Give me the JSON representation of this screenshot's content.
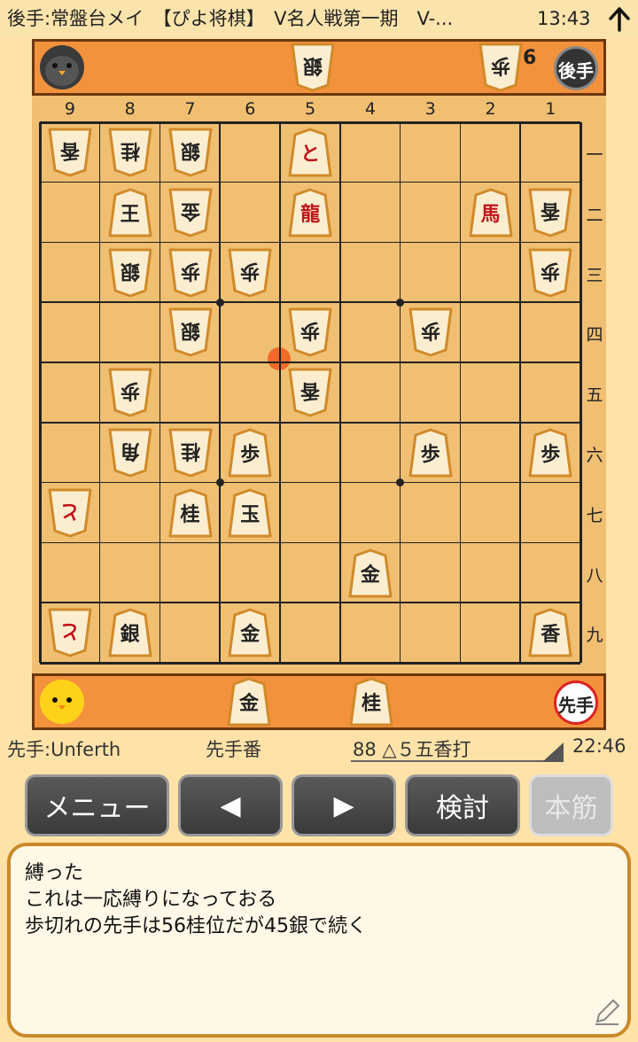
{
  "status": {
    "left_title": "後手:常盤台メイ　【ぴよ将棋】　V名人戦第一期　V-...",
    "time": "13:43"
  },
  "gote_bar": {
    "badge": "後手",
    "hand": [
      {
        "piece": "銀",
        "count": ""
      },
      {
        "piece": "歩",
        "count": "6"
      }
    ]
  },
  "sente_bar": {
    "badge": "先手",
    "hand": [
      {
        "piece": "金",
        "count": ""
      },
      {
        "piece": "桂",
        "count": ""
      }
    ]
  },
  "files": [
    "9",
    "8",
    "7",
    "6",
    "5",
    "4",
    "3",
    "2",
    "1"
  ],
  "ranks": [
    "一",
    "二",
    "三",
    "四",
    "五",
    "六",
    "七",
    "八",
    "九"
  ],
  "pieces": [
    {
      "file": 9,
      "rank": 1,
      "glyph": "香",
      "side": "gote",
      "promoted": false
    },
    {
      "file": 8,
      "rank": 1,
      "glyph": "桂",
      "side": "gote",
      "promoted": false
    },
    {
      "file": 7,
      "rank": 1,
      "glyph": "銀",
      "side": "gote",
      "promoted": false
    },
    {
      "file": 5,
      "rank": 1,
      "glyph": "と",
      "side": "sente",
      "promoted": true
    },
    {
      "file": 8,
      "rank": 2,
      "glyph": "王",
      "side": "sente",
      "promoted": false
    },
    {
      "file": 7,
      "rank": 2,
      "glyph": "金",
      "side": "gote",
      "promoted": false
    },
    {
      "file": 5,
      "rank": 2,
      "glyph": "龍",
      "side": "sente",
      "promoted": true
    },
    {
      "file": 2,
      "rank": 2,
      "glyph": "馬",
      "side": "sente",
      "promoted": true
    },
    {
      "file": 1,
      "rank": 2,
      "glyph": "香",
      "side": "gote",
      "promoted": false
    },
    {
      "file": 8,
      "rank": 3,
      "glyph": "銀",
      "side": "gote",
      "promoted": false
    },
    {
      "file": 7,
      "rank": 3,
      "glyph": "歩",
      "side": "gote",
      "promoted": false
    },
    {
      "file": 6,
      "rank": 3,
      "glyph": "歩",
      "side": "gote",
      "promoted": false
    },
    {
      "file": 1,
      "rank": 3,
      "glyph": "歩",
      "side": "gote",
      "promoted": false
    },
    {
      "file": 7,
      "rank": 4,
      "glyph": "銀",
      "side": "gote",
      "promoted": false
    },
    {
      "file": 5,
      "rank": 4,
      "glyph": "歩",
      "side": "gote",
      "promoted": false
    },
    {
      "file": 3,
      "rank": 4,
      "glyph": "歩",
      "side": "gote",
      "promoted": false
    },
    {
      "file": 8,
      "rank": 5,
      "glyph": "歩",
      "side": "gote",
      "promoted": false
    },
    {
      "file": 5,
      "rank": 5,
      "glyph": "香",
      "side": "gote",
      "promoted": false
    },
    {
      "file": 8,
      "rank": 6,
      "glyph": "角",
      "side": "gote",
      "promoted": false
    },
    {
      "file": 7,
      "rank": 6,
      "glyph": "桂",
      "side": "gote",
      "promoted": false
    },
    {
      "file": 6,
      "rank": 6,
      "glyph": "歩",
      "side": "sente",
      "promoted": false
    },
    {
      "file": 3,
      "rank": 6,
      "glyph": "歩",
      "side": "sente",
      "promoted": false
    },
    {
      "file": 1,
      "rank": 6,
      "glyph": "歩",
      "side": "sente",
      "promoted": false
    },
    {
      "file": 9,
      "rank": 7,
      "glyph": "と",
      "side": "gote",
      "promoted": true
    },
    {
      "file": 7,
      "rank": 7,
      "glyph": "桂",
      "side": "sente",
      "promoted": false
    },
    {
      "file": 6,
      "rank": 7,
      "glyph": "玉",
      "side": "sente",
      "promoted": false
    },
    {
      "file": 4,
      "rank": 8,
      "glyph": "金",
      "side": "sente",
      "promoted": false
    },
    {
      "file": 9,
      "rank": 9,
      "glyph": "と",
      "side": "gote",
      "promoted": true
    },
    {
      "file": 8,
      "rank": 9,
      "glyph": "銀",
      "side": "sente",
      "promoted": false
    },
    {
      "file": 6,
      "rank": 9,
      "glyph": "金",
      "side": "sente",
      "promoted": false
    },
    {
      "file": 1,
      "rank": 9,
      "glyph": "香",
      "side": "sente",
      "promoted": false
    }
  ],
  "last_move": {
    "file": 5,
    "rank": 5
  },
  "info": {
    "sente_player": "先手:Unferth",
    "turn": "先手番",
    "move": "88 △５五香打",
    "clock": "22:46"
  },
  "buttons": {
    "menu": "メニュー",
    "prev": "◀",
    "next": "▶",
    "study": "検討",
    "mainline": "本筋"
  },
  "comment": {
    "lines": [
      "縛った",
      "これは一応縛りになっておる",
      "歩切れの先手は56桂位だが45銀で続く"
    ]
  },
  "colors": {
    "bar": "#f3923c",
    "board": "#f0bf72",
    "promoted": "#c0141a",
    "last_move": "#f26b2a"
  }
}
